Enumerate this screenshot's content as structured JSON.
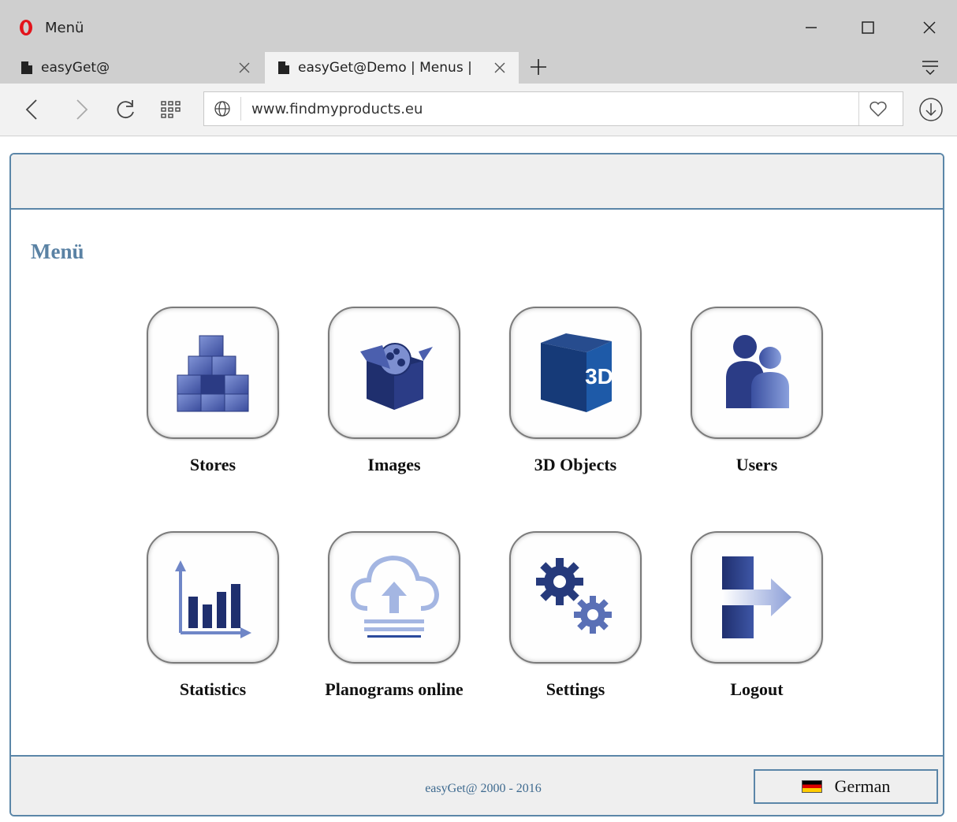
{
  "window": {
    "title": "Menü"
  },
  "tabs": [
    {
      "label": "easyGet@"
    },
    {
      "label": "easyGet@Demo | Menus |"
    }
  ],
  "address": {
    "url": "www.findmyproducts.eu"
  },
  "page": {
    "title": "Menü",
    "menu": [
      {
        "label": "Stores",
        "icon": "stores-boxes-icon"
      },
      {
        "label": "Images",
        "icon": "images-box-icon"
      },
      {
        "label": "3D Objects",
        "icon": "3d-cube-icon",
        "icon_text": "3D"
      },
      {
        "label": "Users",
        "icon": "users-icon"
      },
      {
        "label": "Statistics",
        "icon": "statistics-chart-icon"
      },
      {
        "label": "Planograms online",
        "icon": "cloud-upload-icon"
      },
      {
        "label": "Settings",
        "icon": "gears-icon"
      },
      {
        "label": "Logout",
        "icon": "logout-arrow-icon"
      }
    ],
    "footer": {
      "copyright": "easyGet@ 2000 - 2016",
      "language": "German"
    }
  },
  "colors": {
    "accent": "#5a82a4",
    "icon_dark": "#1f2f6e",
    "icon_light": "#6f86c7"
  }
}
